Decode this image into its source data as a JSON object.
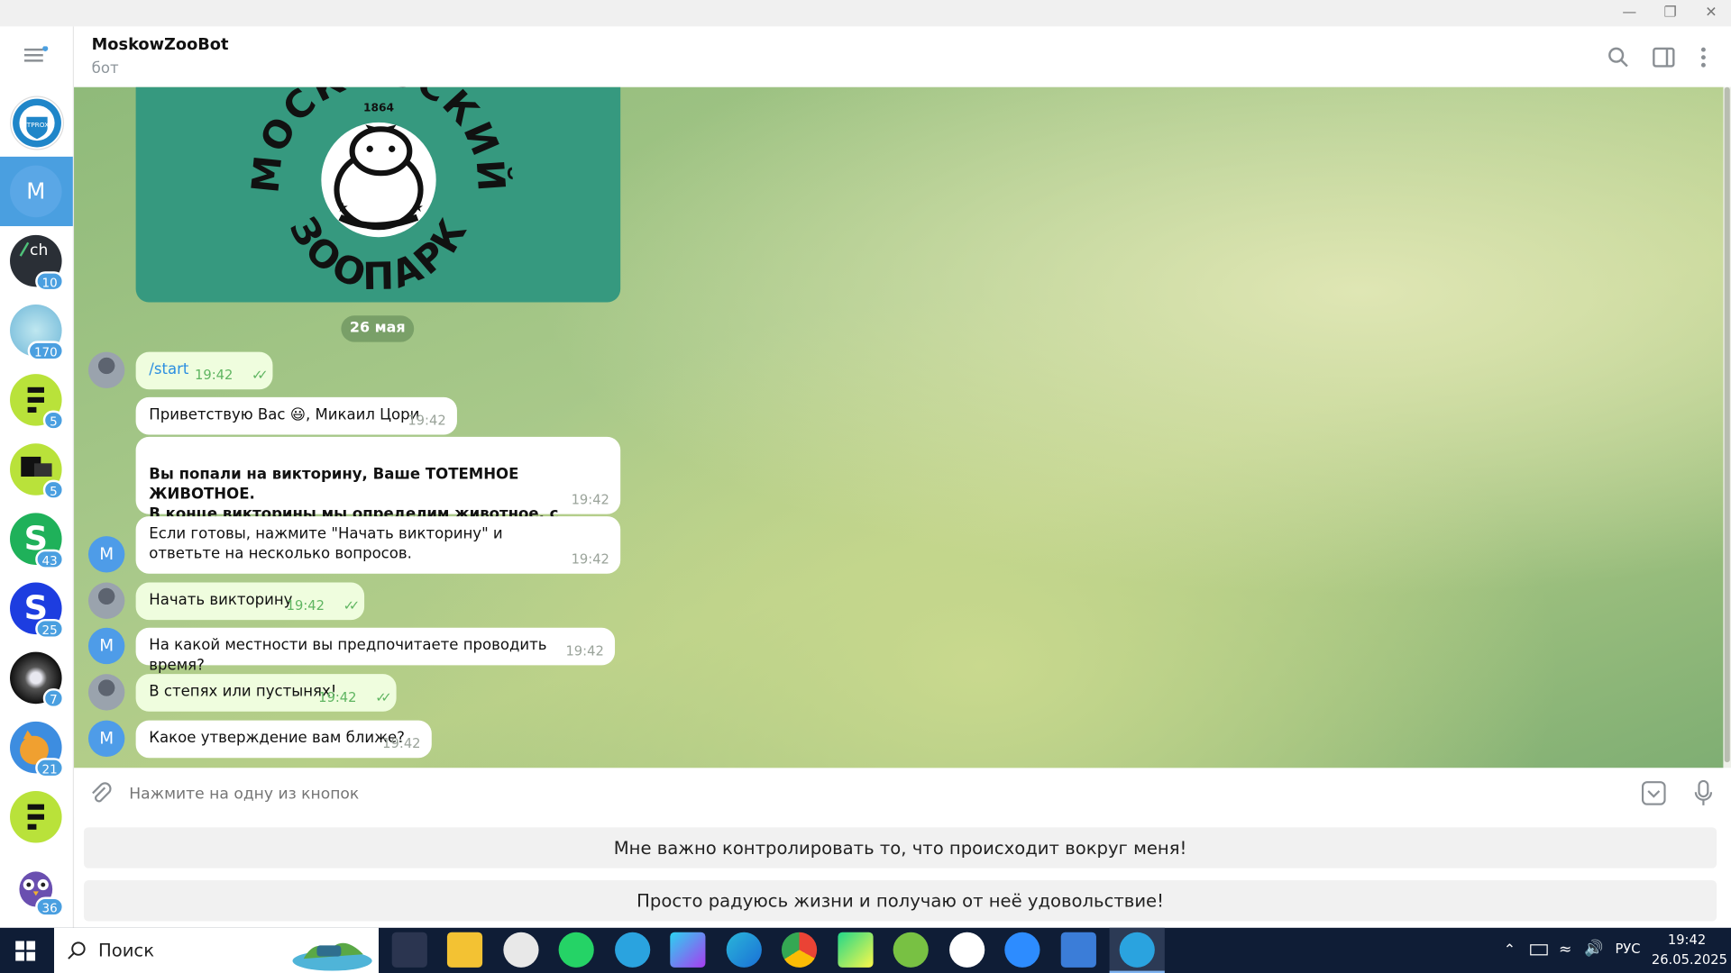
{
  "window": {
    "minimize_icon": "minimize-icon",
    "restore_icon": "restore-icon",
    "close_icon": "close-icon"
  },
  "header": {
    "title": "MoskowZooBot",
    "subtitle": "бот"
  },
  "sidebar": {
    "chats": [
      {
        "name": "MTProxy",
        "badge": ""
      },
      {
        "name": "M",
        "badge": ""
      },
      {
        "name": "ch",
        "badge": "10"
      },
      {
        "name": "channel",
        "badge": "170"
      },
      {
        "name": "green-app",
        "badge": "5"
      },
      {
        "name": "green-app-2",
        "badge": "5"
      },
      {
        "name": "s-green",
        "badge": "43"
      },
      {
        "name": "s-blue",
        "badge": "25"
      },
      {
        "name": "galaxy",
        "badge": "7"
      },
      {
        "name": "cat",
        "badge": "21"
      },
      {
        "name": "green-app-3",
        "badge": ""
      },
      {
        "name": "owl",
        "badge": "36"
      }
    ],
    "m_letter": "M",
    "ch_label": "ch"
  },
  "logo": {
    "text_top": "МОСКОВСКИЙ",
    "text_bottom": "ЗООПАРК",
    "year": "1864"
  },
  "date_chip": "26 мая",
  "messages": [
    {
      "dir": "out",
      "text": "/start",
      "time": "19:42"
    },
    {
      "dir": "in",
      "text": "Приветствую Вас 😃, Микаил Цори",
      "time": "19:42"
    },
    {
      "dir": "in",
      "text": "Вы попали на викторину, Ваше ТОТЕМНОЕ ЖИВОТНОЕ.\n В конце викторины мы определим животное, с которым у Вас схожая энергетика 🐯🐻🦊🐱🐶🐼!",
      "time": "19:42"
    },
    {
      "dir": "in",
      "text": "Если готовы, нажмите \"Начать викторину\" и ответьте на несколько вопросов.",
      "time": "19:42"
    },
    {
      "dir": "out",
      "text": "Начать викторину",
      "time": "19:42"
    },
    {
      "dir": "in",
      "text": "На какой местности вы предпочитаете проводить время?",
      "time": "19:42"
    },
    {
      "dir": "out",
      "text": "В степях или пустынях!",
      "time": "19:42"
    },
    {
      "dir": "in",
      "text": "Какое утверждение вам ближе?",
      "time": "19:42"
    }
  ],
  "bot_avatar_letter": "M",
  "input": {
    "placeholder": "Нажмите на одну из кнопок"
  },
  "keyboard": [
    "Мне важно контролировать то, что происходит вокруг меня!",
    "Просто радуюсь жизни и получаю от неё удовольствие!"
  ],
  "taskbar": {
    "search_label": "Поиск",
    "language": "РУС",
    "time": "19:42",
    "date": "26.05.2025",
    "apps": [
      "speedometer-app-icon",
      "file-explorer-icon",
      "panda-app-icon",
      "whatsapp-icon",
      "telegram-icon",
      "webstorm-icon",
      "edge-icon",
      "chrome-icon",
      "pycharm-icon",
      "utorrent-icon",
      "github-icon",
      "zoom-icon",
      "app-icon",
      "telegram-active-icon"
    ]
  },
  "colors": {
    "accent": "#4a9fe0",
    "outgoing_bubble": "#effdde",
    "zoo_green": "#36997f",
    "check_green": "#5fb561"
  }
}
